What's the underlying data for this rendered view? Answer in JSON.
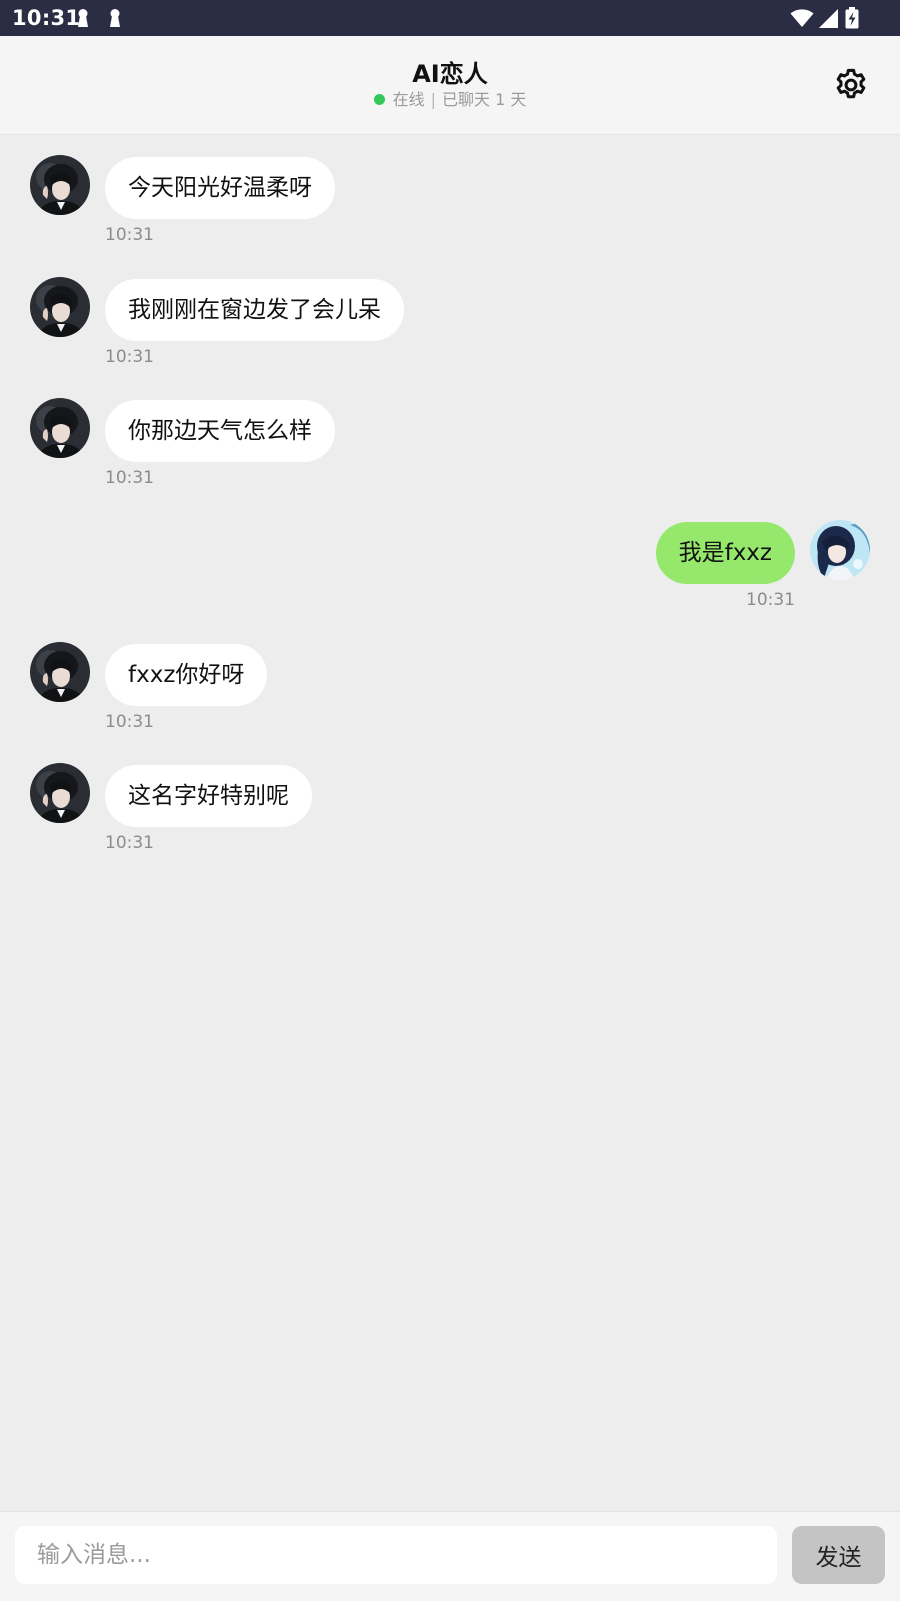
{
  "status_bar": {
    "time": "10:31",
    "notification_icons": [
      "keyhole-icon",
      "keyhole-icon"
    ],
    "system_icons": [
      "wifi-icon",
      "signal-icon",
      "battery-charging-icon"
    ]
  },
  "header": {
    "title": "AI恋人",
    "status": "在线",
    "separator": "|",
    "chat_days": "已聊天 1 天",
    "settings_icon": "gear-icon",
    "online_color": "#34c759"
  },
  "messages": [
    {
      "role": "ai",
      "text": "今天阳光好温柔呀",
      "time": "10:31"
    },
    {
      "role": "ai",
      "text": "我刚刚在窗边发了会儿呆",
      "time": "10:31"
    },
    {
      "role": "ai",
      "text": "你那边天气怎么样",
      "time": "10:31"
    },
    {
      "role": "user",
      "text": "我是fxxz",
      "time": "10:31"
    },
    {
      "role": "ai",
      "text": "fxxz你好呀",
      "time": "10:31"
    },
    {
      "role": "ai",
      "text": "这名字好特别呢",
      "time": "10:31"
    }
  ],
  "input": {
    "placeholder": "输入消息...",
    "value": "",
    "send_label": "发送"
  },
  "colors": {
    "user_bubble": "#95e86b",
    "ai_bubble": "#ffffff",
    "background": "#ededed",
    "status_bar": "#2b2d44"
  }
}
